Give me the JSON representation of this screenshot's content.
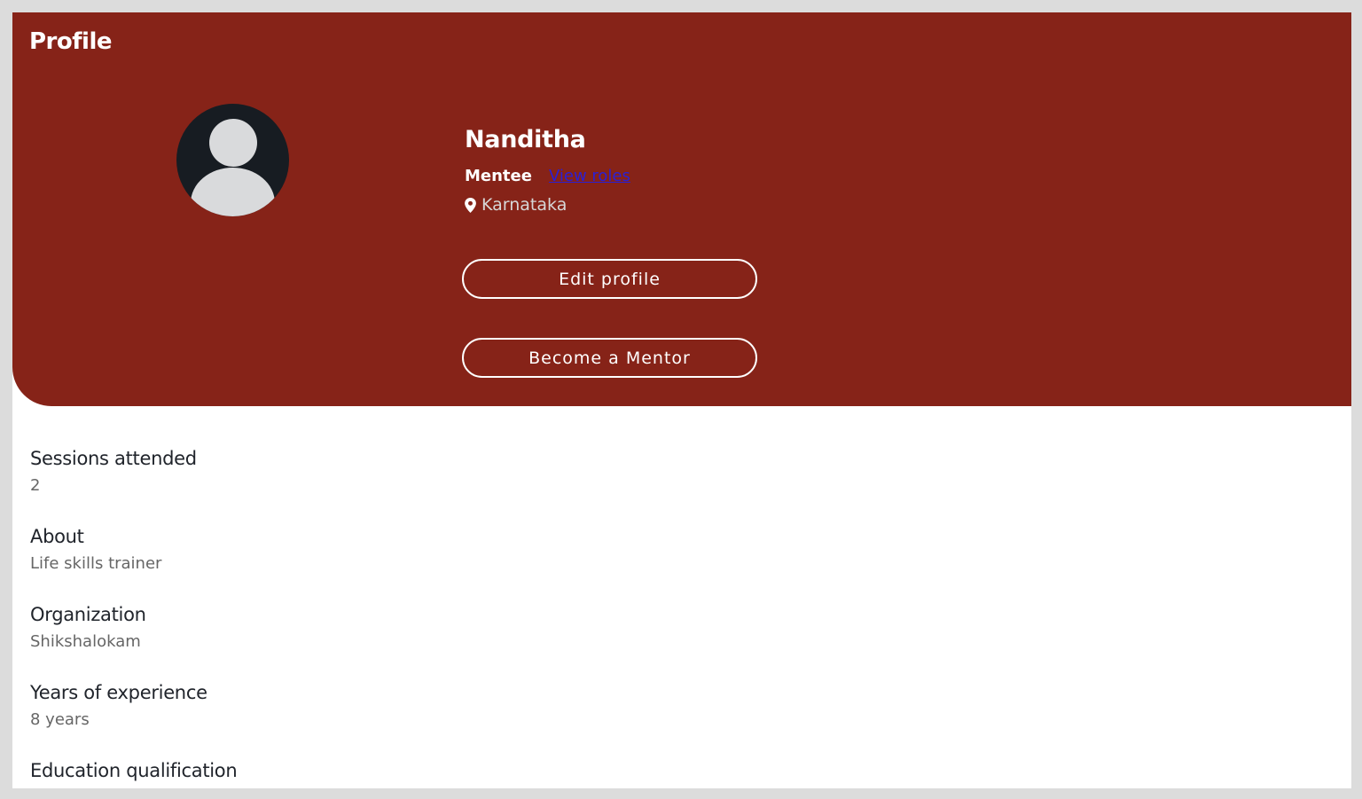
{
  "page": {
    "title": "Profile"
  },
  "profile": {
    "name": "Nanditha",
    "role": "Mentee",
    "view_roles_link": "View roles",
    "location": "Karnataka",
    "edit_button": "Edit profile",
    "mentor_button": "Become a Mentor"
  },
  "details": [
    {
      "label": "Sessions attended",
      "value": "2"
    },
    {
      "label": "About",
      "value": "Life skills trainer"
    },
    {
      "label": "Organization",
      "value": "Shikshalokam"
    },
    {
      "label": "Years of experience",
      "value": "8 years"
    },
    {
      "label": "Education qualification",
      "value": ""
    }
  ],
  "colors": {
    "banner": "#862318",
    "link": "#2a1fd6",
    "avatar_bg": "#171c22",
    "avatar_fg": "#d9dadc"
  },
  "icons": {
    "avatar": "user-silhouette-icon",
    "location": "map-pin-icon"
  }
}
